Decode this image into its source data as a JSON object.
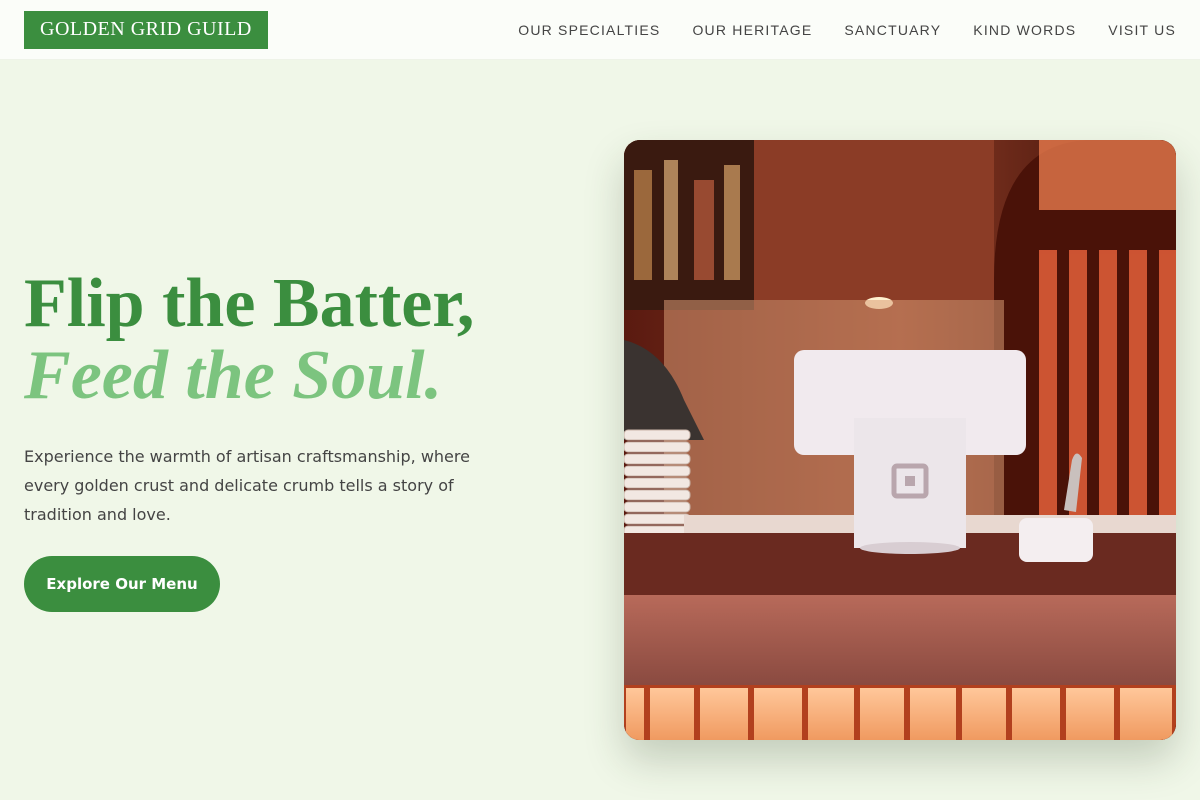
{
  "brand": {
    "name": "GOLDEN GRID GUILD"
  },
  "nav": {
    "items": [
      {
        "label": "OUR SPECIALTIES"
      },
      {
        "label": "OUR HERITAGE"
      },
      {
        "label": "SANCTUARY"
      },
      {
        "label": "KIND WORDS"
      },
      {
        "label": "VISIT US"
      }
    ]
  },
  "hero": {
    "title_line1": "Flip the Batter,",
    "title_line2": "Feed the Soul.",
    "description": "Experience the warmth of artisan craftsmanship, where every golden crust and delicate crumb tells a story of tradition and love.",
    "cta_label": "Explore Our Menu"
  },
  "colors": {
    "primary": "#3b8e3f",
    "accent_light": "#7cc47f",
    "background": "#f0f7e8"
  }
}
